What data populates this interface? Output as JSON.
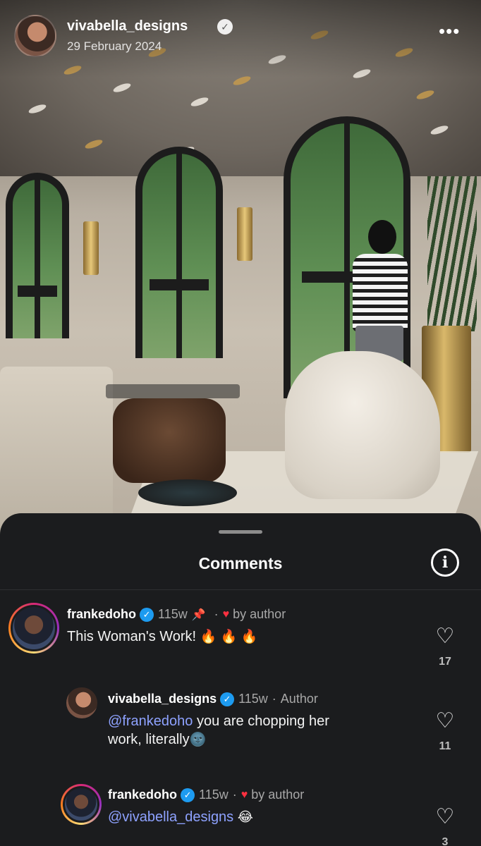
{
  "post": {
    "username": "vivabella_designs",
    "date": "29 February 2024",
    "more_label": "•••"
  },
  "comments_panel": {
    "title": "Comments",
    "info_label": "i"
  },
  "comments": [
    {
      "username": "frankedoho",
      "age": "115w",
      "pinned": true,
      "liked_by_author_label": "by author",
      "text": "This Woman's Work!",
      "emoji": "🔥 🔥 🔥",
      "likes": "17"
    },
    {
      "username": "vivabella_designs",
      "age": "115w",
      "author_label": "Author",
      "mention": "@frankedoho",
      "text_line1": " you are chopping her",
      "text_line2": "work, literally",
      "emoji": "🌚",
      "likes": "11"
    },
    {
      "username": "frankedoho",
      "age": "115w",
      "liked_by_author_label": "by author",
      "mention": "@vivabella_designs",
      "emoji": "😂",
      "likes": "3"
    }
  ],
  "icons": {
    "verified": "verified-check-icon",
    "pin": "pin-icon",
    "heart_filled": "heart-filled-icon",
    "heart_outline": "heart-outline-icon",
    "info": "info-icon"
  },
  "colors": {
    "sheet_bg": "#1b1c1e",
    "verified_blue": "#1d9bf0",
    "mention_blue": "#8ea2ff",
    "heart_red": "#ff3040"
  }
}
